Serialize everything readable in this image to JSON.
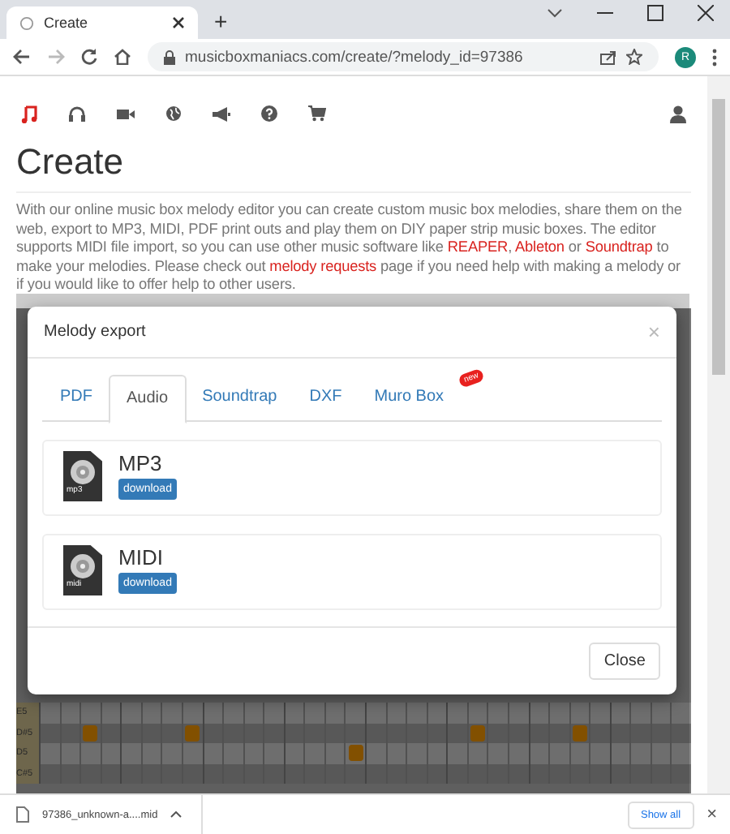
{
  "browser": {
    "tab_title": "Create",
    "new_tab": "+",
    "url": "musicboxmaniacs.com/create/?melody_id=97386",
    "profile_initial": "R"
  },
  "nav": {
    "items": [
      {
        "selected": true
      },
      {
        "selected": false
      },
      {
        "selected": false
      },
      {
        "selected": false
      },
      {
        "selected": false
      },
      {
        "selected": false
      },
      {
        "selected": false
      }
    ]
  },
  "page": {
    "title": "Create",
    "intro": [
      {
        "text": "With our online music box melody editor you can create custom music box melodies, share them on the web, export to MP3, MIDI, PDF print outs and play them on DIY paper strip music boxes. The editor supports MIDI file import, so you can use other music software like ",
        "link": false
      },
      {
        "text": "REAPER",
        "link": true
      },
      {
        "text": ", ",
        "link": false
      },
      {
        "text": "Ableton",
        "link": true
      },
      {
        "text": " or ",
        "link": false
      },
      {
        "text": "Soundtrap",
        "link": true
      },
      {
        "text": " to make your melodies. Please check out ",
        "link": false
      },
      {
        "text": "melody requests",
        "link": true
      },
      {
        "text": " page if you need help with making a melody or if you would like to offer help to other users.",
        "link": false
      }
    ]
  },
  "editor": {
    "rows": [
      {
        "label": "E5",
        "notes": [
          false,
          false,
          false,
          false,
          false,
          false,
          false,
          false,
          false,
          false,
          false,
          false,
          false,
          false,
          false,
          false,
          false,
          false,
          false,
          false,
          false,
          false,
          false,
          false,
          false,
          false,
          false,
          false,
          false,
          false,
          false,
          false
        ]
      },
      {
        "label": "D#5",
        "notes": [
          false,
          false,
          true,
          false,
          false,
          false,
          false,
          true,
          false,
          false,
          false,
          false,
          false,
          false,
          false,
          false,
          false,
          false,
          false,
          false,
          false,
          true,
          false,
          false,
          false,
          false,
          true,
          false,
          false,
          false,
          false,
          false
        ]
      },
      {
        "label": "D5",
        "notes": [
          false,
          false,
          false,
          false,
          false,
          false,
          false,
          false,
          false,
          false,
          false,
          false,
          false,
          false,
          false,
          true,
          false,
          false,
          false,
          false,
          false,
          false,
          false,
          false,
          false,
          false,
          false,
          false,
          false,
          false,
          false,
          false
        ]
      },
      {
        "label": "C#5",
        "notes": [
          false,
          false,
          false,
          false,
          false,
          false,
          false,
          false,
          false,
          false,
          false,
          false,
          false,
          false,
          false,
          false,
          false,
          false,
          false,
          false,
          false,
          false,
          false,
          false,
          false,
          false,
          false,
          false,
          false,
          false,
          false,
          false
        ]
      }
    ]
  },
  "modal": {
    "title": "Melody export",
    "close_icon": "×",
    "tabs": [
      {
        "label": "PDF",
        "selected": false
      },
      {
        "label": "Audio",
        "selected": true
      },
      {
        "label": "Soundtrap",
        "selected": false
      },
      {
        "label": "DXF",
        "selected": false
      },
      {
        "label": "Muro Box",
        "selected": false,
        "badge": "new"
      }
    ],
    "files": [
      {
        "name": "MP3",
        "icon_label": "mp3",
        "button": "download"
      },
      {
        "name": "MIDI",
        "icon_label": "midi",
        "button": "download"
      }
    ],
    "close_button": "Close"
  },
  "download_bar": {
    "file": "97386_unknown-a....mid",
    "show_all": "Show all",
    "close_icon": "×"
  }
}
